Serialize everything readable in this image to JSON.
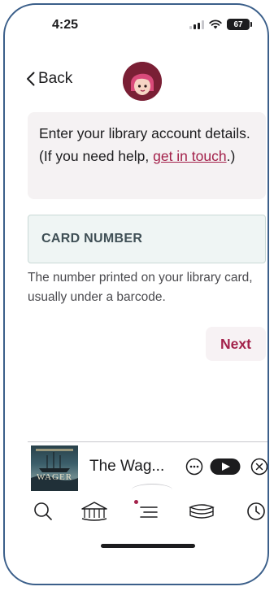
{
  "status_bar": {
    "time": "4:25",
    "battery": "67"
  },
  "nav": {
    "back_label": "Back"
  },
  "info": {
    "text_before": "Enter your library account details. (If you need help, ",
    "link": "get in touch",
    "text_after": ".)"
  },
  "card_field": {
    "label": "CARD NUMBER",
    "hint": "The number printed on your library card, usually under a barcode."
  },
  "next_button": "Next",
  "mini_player": {
    "title": "The Wag...",
    "cover_text": "WAGER"
  },
  "tabbar": {
    "items": [
      "search-icon",
      "library-icon",
      "menu-icon",
      "books-icon",
      "history-icon"
    ],
    "active": 2
  },
  "colors": {
    "accent": "#a3214a",
    "logo": "#7a1f35",
    "frame": "#3b5f8a"
  }
}
